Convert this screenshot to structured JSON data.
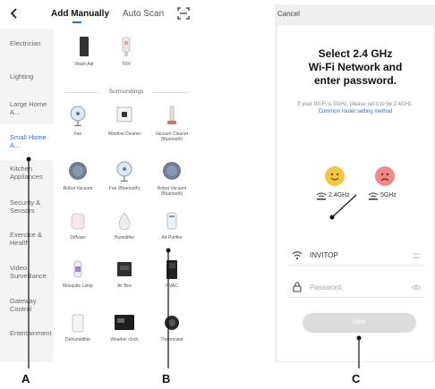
{
  "header": {
    "tabs": [
      "Add Manually",
      "Auto Scan"
    ]
  },
  "sidebar": {
    "items": [
      {
        "label": "Electrician"
      },
      {
        "label": "Lighting"
      },
      {
        "label": "Large Home A..."
      },
      {
        "label": "Small Home A..."
      },
      {
        "label": "Kitchen Appliances"
      },
      {
        "label": "Security & Sensors"
      },
      {
        "label": "Exercise & Health"
      },
      {
        "label": "Video Surveillance"
      },
      {
        "label": "Gateway Control"
      },
      {
        "label": "Entertainment"
      }
    ]
  },
  "devices_top": [
    {
      "label": "Wash Aid",
      "icon": "wash-aid-icon"
    },
    {
      "label": "TRV",
      "icon": "trv-icon"
    }
  ],
  "section_title": "Surroundings",
  "devices": [
    {
      "label": "Fan",
      "icon": "fan-icon"
    },
    {
      "label": "Window Cleaner",
      "icon": "window-cleaner-icon"
    },
    {
      "label": "Vacuum Cleaner (Bluetooth)",
      "icon": "vacuum-cleaner-icon"
    },
    {
      "label": "Robot Vacuum",
      "icon": "robot-vacuum-icon"
    },
    {
      "label": "Fan (Bluetooth)",
      "icon": "fan-icon"
    },
    {
      "label": "Robot Vacuum (Bluetooth)",
      "icon": "robot-vacuum-icon"
    },
    {
      "label": "Diffuser",
      "icon": "diffuser-icon"
    },
    {
      "label": "Humidifier",
      "icon": "humidifier-icon"
    },
    {
      "label": "Air Purifier",
      "icon": "air-purifier-icon"
    },
    {
      "label": "Mosquito Lamp",
      "icon": "mosquito-lamp-icon"
    },
    {
      "label": "Air Box",
      "icon": "air-box-icon"
    },
    {
      "label": "HVAC",
      "icon": "hvac-icon"
    },
    {
      "label": "Dehumidifier",
      "icon": "dehumidifier-icon"
    },
    {
      "label": "Weather clock",
      "icon": "weather-clock-icon"
    },
    {
      "label": "Thermostat",
      "icon": "thermostat-icon"
    }
  ],
  "wifi_screen": {
    "cancel": "Cancel",
    "title_line1": "Select 2.4 GHz",
    "title_line2": "Wi-Fi Network and",
    "title_line3": "enter password.",
    "hint": "If your Wi-Fi is 5GHz, please set it to be 2.4GHz.",
    "hint_link": "Common router setting method",
    "freq_ok": "2.4GHz",
    "freq_bad": "5GHz",
    "wifi_name": "INVITOP",
    "password_placeholder": "Password",
    "next_label": "Next"
  },
  "callouts": {
    "a": "A",
    "b": "B",
    "c": "C"
  },
  "colors": {
    "accent": "#2b6fd6",
    "happy_face": "#f5c544",
    "sad_face": "#f08a8a",
    "button_disabled": "#dcdcdc"
  }
}
